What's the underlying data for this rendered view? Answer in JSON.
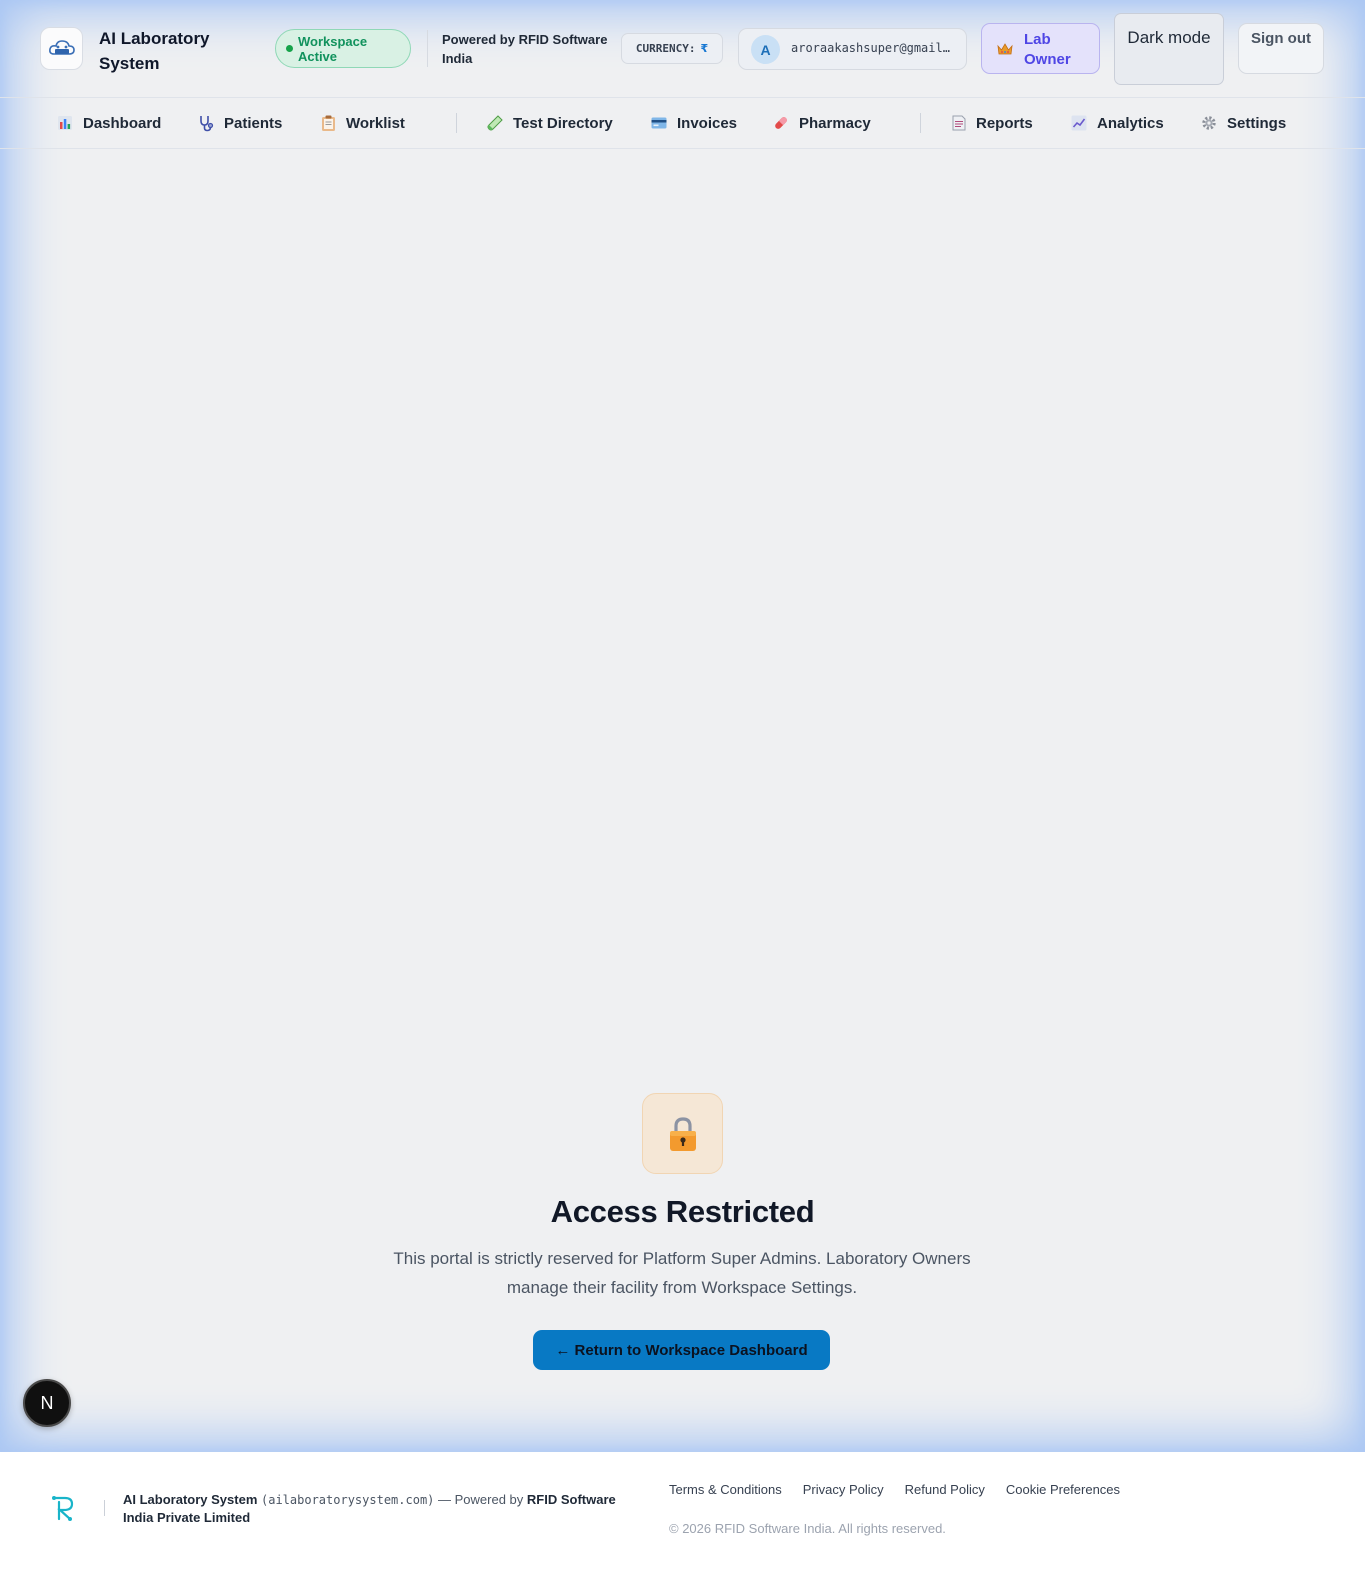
{
  "header": {
    "app_title": "AI Laboratory System",
    "logo_icon": "ai-lab-cloud-logo",
    "workspace_status": "Workspace Active",
    "powered_by": "Powered by RFID Software India",
    "currency_label": "CURRENCY:",
    "currency_symbol": "₹",
    "user_initial": "A",
    "user_email": "aroraakashsuper@gmail.com",
    "role_label": "Lab Owner",
    "role_icon": "crown-icon",
    "dark_mode_label": "Dark mode",
    "sign_out_label": "Sign out"
  },
  "nav": {
    "items": [
      {
        "label": "Dashboard",
        "icon": "bar-chart-icon"
      },
      {
        "label": "Patients",
        "icon": "stethoscope-icon"
      },
      {
        "label": "Worklist",
        "icon": "clipboard-icon"
      },
      {
        "label": "Test Directory",
        "icon": "test-tube-icon"
      },
      {
        "label": "Invoices",
        "icon": "credit-card-icon"
      },
      {
        "label": "Pharmacy",
        "icon": "pill-icon"
      },
      {
        "label": "Reports",
        "icon": "document-icon"
      },
      {
        "label": "Analytics",
        "icon": "trend-chart-icon"
      },
      {
        "label": "Settings",
        "icon": "gear-icon"
      }
    ]
  },
  "main": {
    "lock_icon": "lock-icon",
    "title": "Access Restricted",
    "message": "This portal is strictly reserved for Platform Super Admins. Laboratory Owners manage their facility from Workspace Settings.",
    "return_button": "← Return to Workspace Dashboard",
    "dev_badge": "N"
  },
  "footer": {
    "logo_icon": "rfid-r-logo",
    "brand": "AI Laboratory System",
    "domain": "(ailaboratorysystem.com)",
    "powered_prefix": "— Powered by",
    "company": "RFID Software India Private Limited",
    "links": [
      "Terms & Conditions",
      "Privacy Policy",
      "Refund Policy",
      "Cookie Preferences"
    ],
    "copyright": "© 2026 RFID Software India. All rights reserved."
  },
  "colors": {
    "accent": "#0879c4",
    "workspace_green": "#11925d",
    "role_purple": "#4f46e5",
    "page_bg": "#eff0f2"
  }
}
